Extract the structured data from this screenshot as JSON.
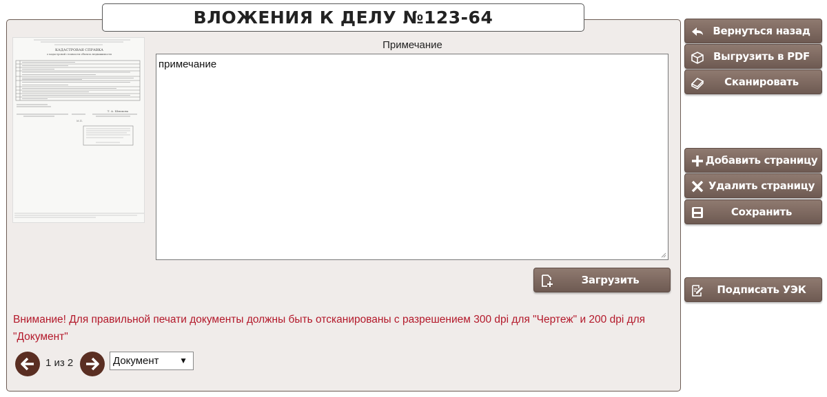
{
  "header": {
    "title": "ВЛОЖЕНИЯ К ДЕЛУ №123-64"
  },
  "note": {
    "label": "Примечание",
    "value": "примечание"
  },
  "upload": {
    "label": "Загрузить"
  },
  "sidebar": {
    "back": "Вернуться назад",
    "export_pdf": "Выгрузить в PDF",
    "scan": "Сканировать",
    "add_page": "Добавить страницу",
    "delete_page": "Удалить страницу",
    "save": "Сохранить",
    "sign": "Подписать УЭК"
  },
  "warning": {
    "line1": "Внимание! Для правильной печати документы должны быть отсканированы с разрешением 300 dpi для \"Чертеж\" и 200 dpi для",
    "line2": "\"Документ\""
  },
  "pager": {
    "text": "1 из 2"
  },
  "doc_type": {
    "selected": "Документ"
  },
  "thumbnail": {
    "heading": "КАДАСТРОВАЯ СПРАВКА",
    "subheading": "о кадастровой стоимости объекта недвижимости",
    "signature_name": "Т. А. Шмакова"
  },
  "colors": {
    "accent_button": "#7d6860",
    "warning": "#b3182a",
    "nav": "#5a2e22"
  }
}
